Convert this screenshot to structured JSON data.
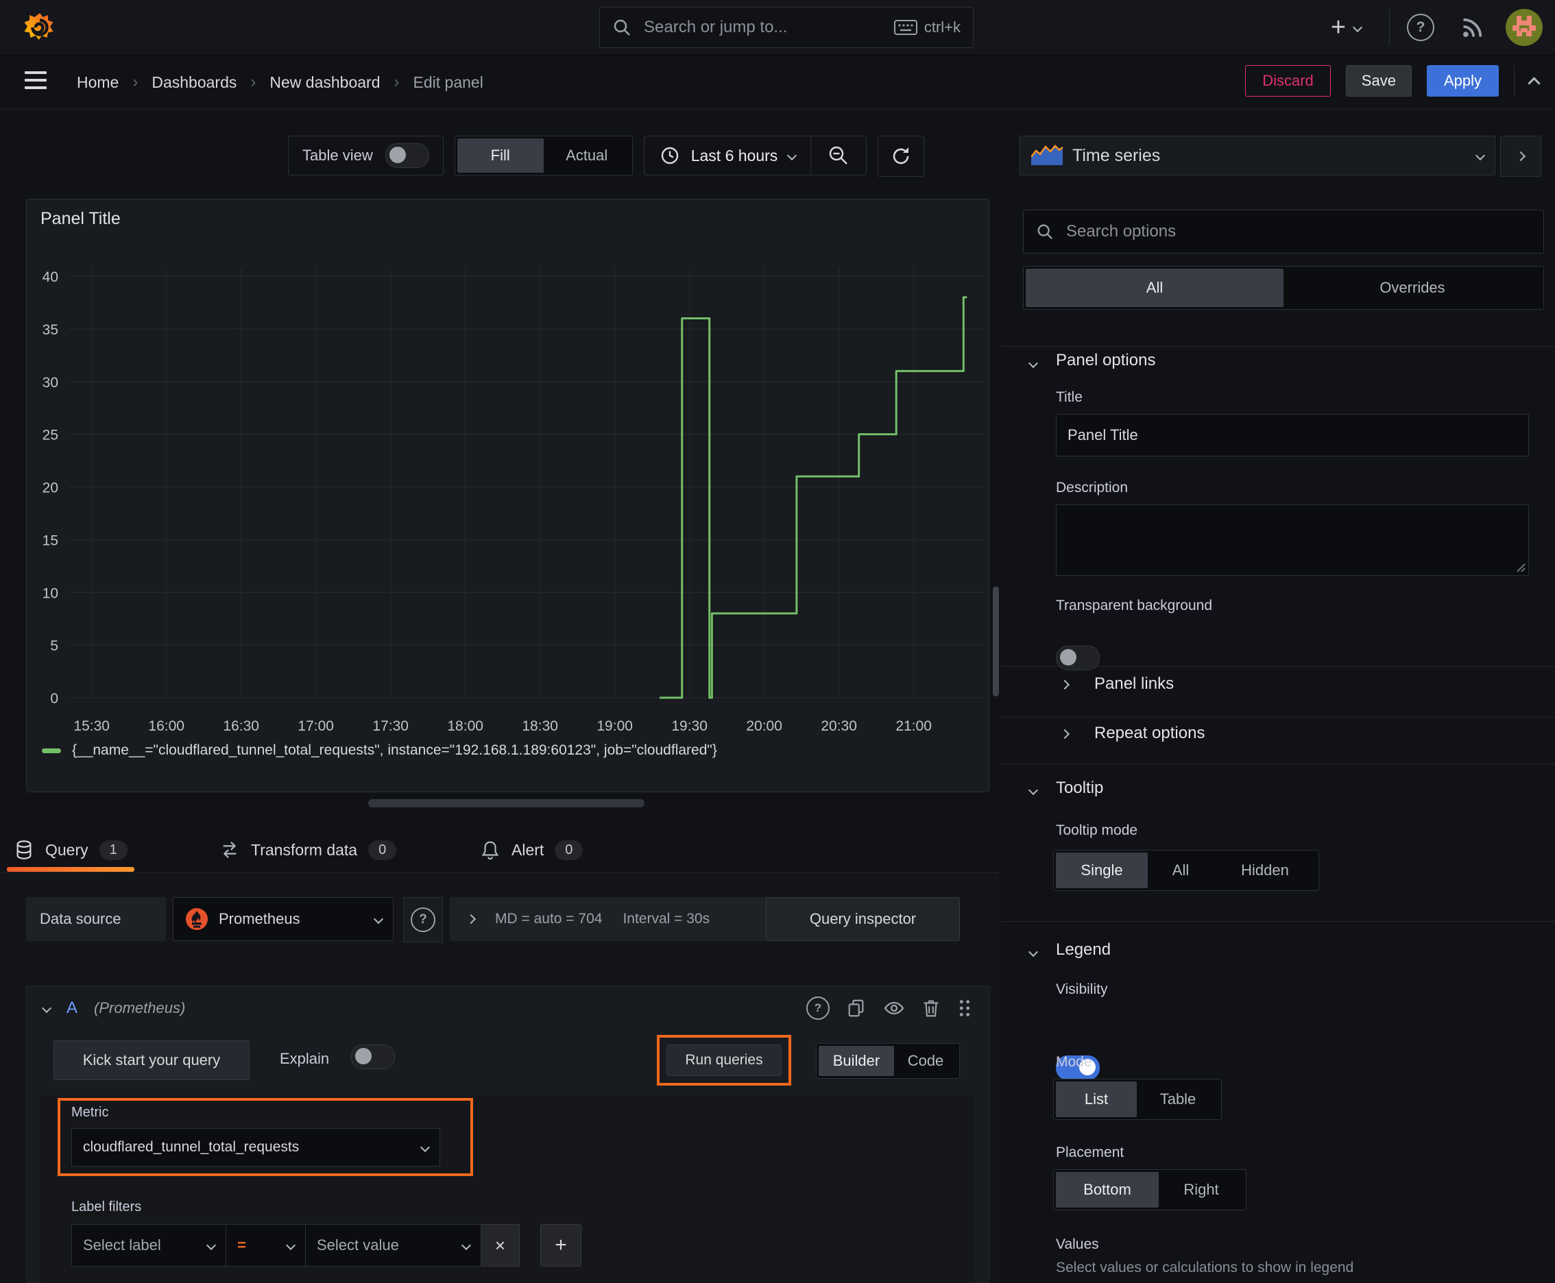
{
  "topbar": {
    "search_placeholder": "Search or jump to...",
    "search_shortcut": "ctrl+k"
  },
  "breadcrumb": {
    "items": [
      "Home",
      "Dashboards",
      "New dashboard"
    ],
    "current": "Edit panel"
  },
  "actions": {
    "discard": "Discard",
    "save": "Save",
    "apply": "Apply"
  },
  "toolbar": {
    "table_view": "Table view",
    "fill": "Fill",
    "actual": "Actual",
    "time_range": "Last 6 hours"
  },
  "panel": {
    "title": "Panel Title"
  },
  "chart_data": {
    "type": "line",
    "line_style": "step-after",
    "title": "Panel Title",
    "x_ticks": [
      "15:30",
      "16:00",
      "16:30",
      "17:00",
      "17:30",
      "18:00",
      "18:30",
      "19:00",
      "19:30",
      "20:00",
      "20:30",
      "21:00"
    ],
    "x_range": [
      "15:21",
      "21:29"
    ],
    "y_ticks": [
      0,
      5,
      10,
      15,
      20,
      25,
      30,
      35,
      40
    ],
    "ylim": [
      0,
      40
    ],
    "grid": true,
    "legend_position": "bottom",
    "series": [
      {
        "name": "{__name__=\"cloudflared_tunnel_total_requests\", instance=\"192.168.1.189:60123\", job=\"cloudflared\"}",
        "color": "#73bf69",
        "points_time_value": [
          [
            "19:18",
            0
          ],
          [
            "19:27",
            36
          ],
          [
            "19:38",
            0
          ],
          [
            "19:39",
            8
          ],
          [
            "20:13",
            21
          ],
          [
            "20:38",
            25
          ],
          [
            "20:53",
            31
          ],
          [
            "21:20",
            38
          ]
        ]
      }
    ]
  },
  "tabs": {
    "query": "Query",
    "query_count": "1",
    "transform": "Transform data",
    "transform_count": "0",
    "alert": "Alert",
    "alert_count": "0"
  },
  "query_editor": {
    "data_source_label": "Data source",
    "data_source": "Prometheus",
    "max_data_points": "MD = auto = 704",
    "interval": "Interval = 30s",
    "query_inspector": "Query inspector",
    "ref_id": "A",
    "ds_hint": "(Prometheus)",
    "kick_start": "Kick start your query",
    "explain": "Explain",
    "run_queries": "Run queries",
    "builder": "Builder",
    "code": "Code",
    "metric_label": "Metric",
    "metric_value": "cloudflared_tunnel_total_requests",
    "label_filters": "Label filters",
    "select_label": "Select label",
    "operator": "=",
    "select_value": "Select value"
  },
  "icons_text": {
    "remove_filter": "×",
    "add_filter": "+",
    "plus": "+"
  },
  "options_pane": {
    "visualization": "Time series",
    "search_placeholder": "Search options",
    "tab_all": "All",
    "tab_overrides": "Overrides",
    "panel_options": "Panel options",
    "title_label": "Title",
    "title_value": "Panel Title",
    "description_label": "Description",
    "transparent_bg": "Transparent background",
    "panel_links": "Panel links",
    "repeat_options": "Repeat options",
    "tooltip": "Tooltip",
    "tooltip_mode": "Tooltip mode",
    "tooltip_single": "Single",
    "tooltip_all": "All",
    "tooltip_hidden": "Hidden",
    "legend": "Legend",
    "visibility": "Visibility",
    "mode": "Mode",
    "mode_list": "List",
    "mode_table": "Table",
    "placement": "Placement",
    "placement_bottom": "Bottom",
    "placement_right": "Right",
    "values_label": "Values",
    "values_hint": "Select values or calculations to show in legend"
  },
  "states": {
    "table_view": false,
    "explain": false,
    "transparent_background": false,
    "legend_visibility": true,
    "fill_mode": "Fill",
    "options_tab": "All",
    "tooltip_mode": "Single",
    "legend_mode": "List",
    "legend_placement": "Bottom",
    "editor_mode": "Builder"
  },
  "colors": {
    "accent_orange": "#f2691c",
    "series_green": "#73bf69",
    "primary_blue": "#3d71d9",
    "danger_red": "#e0306e"
  }
}
